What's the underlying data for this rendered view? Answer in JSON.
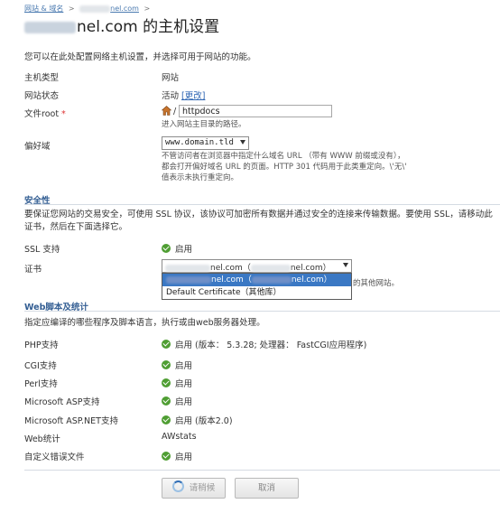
{
  "breadcrumb": {
    "root": "网站 & 域名",
    "separator": ">",
    "domain_suffix": "nel.com",
    "trailing": ">"
  },
  "title": {
    "domain_suffix": "nel.com",
    "text": " 的主机设置"
  },
  "intro": "您可以在此处配置网络主机设置，并选择可用于网站的功能。",
  "hosting": {
    "type_label": "主机类型",
    "type_value": "网站",
    "status_label": "网站状态",
    "status_value": "活动",
    "status_change": "[更改]",
    "docroot_label": "文件root",
    "docroot_required": "*",
    "docroot_slash": "/",
    "docroot_value": "httpdocs",
    "docroot_hint": "进入网站主目录的路径。",
    "pref_label": "偏好域",
    "pref_value": "www.domain.tld",
    "pref_hint_1": "不管访问者在浏览器中指定什么域名 URL （带有 WWW 前缀或没有），",
    "pref_hint_2": "都会打开偏好域名 URL 的页面。HTTP 301 代码用于此类重定向。\\'无\\'",
    "pref_hint_3": "值表示未执行重定向。"
  },
  "security": {
    "title": "安全性",
    "desc": "要保证您网站的交易安全，可使用 SSL 协议，该协议可加密所有数据并通过安全的连接来传输数据。要使用 SSL，请移动此证书，然后在下面选择它。",
    "ssl_label": "SSL 支持",
    "ssl_value": "启用",
    "cert_label": "证书",
    "cert_selected_suffix": "nel.com（",
    "cert_selected_tail": "nel.com）",
    "cert_option_1": "nel.com（",
    "cert_option_1_tail": "nel.com）",
    "cert_option_2": "Default Certificate（其他库）",
    "cert_hint_tail": "的其他网站。"
  },
  "web": {
    "title": "Web脚本及统计",
    "desc": "指定应编译的哪些程序及脚本语言，执行或由web服务器处理。",
    "rows": [
      {
        "label": "PHP支持",
        "value": "启用 (版本： 5.3.28; 处理器： FastCGI应用程序)",
        "check": true
      },
      {
        "label": "CGI支持",
        "value": "启用",
        "check": true
      },
      {
        "label": "Perl支持",
        "value": "启用",
        "check": true
      },
      {
        "label": "Microsoft ASP支持",
        "value": "启用",
        "check": true
      },
      {
        "label": "Microsoft ASP.NET支持",
        "value": "启用 (版本2.0)",
        "check": true
      },
      {
        "label": "Web统计",
        "value": "AWstats",
        "check": false
      },
      {
        "label": "自定义错误文件",
        "value": "启用",
        "check": true
      }
    ]
  },
  "buttons": {
    "wait": "请稍候",
    "cancel": "取消"
  },
  "colors": {
    "link": "#2f66b3",
    "section": "#335e93",
    "check": "#4f9e33",
    "selection": "#3a78c4"
  }
}
